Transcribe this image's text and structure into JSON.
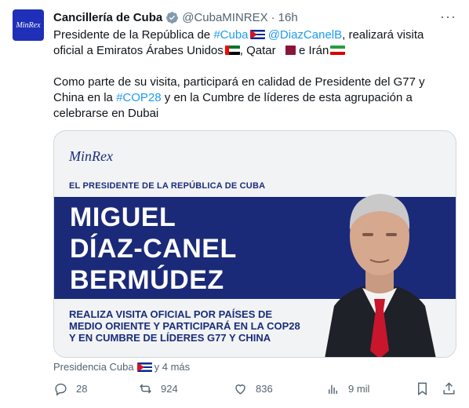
{
  "tweet": {
    "author_name": "Cancillería de Cuba",
    "handle": "@CubaMINREX",
    "separator": "·",
    "time": "16h",
    "more": "···",
    "avatar_text": "MinRex",
    "text": {
      "p1_a": "Presidente de la República de ",
      "hashtag_cuba": "#Cuba",
      "mention": "@DiazCanelB",
      "p1_b": ", realizará visita oficial a Emiratos Árabes Unidos",
      "p1_c": ", Qatar ",
      "p1_d": " e Irán",
      "p2_a": "Como parte de su visita, participará en calidad de Presidente del G77 y China en la ",
      "hashtag_cop": "#COP28",
      "p2_b": " y en la Cumbre de líderes de esta agrupación a celebrarse en Dubai"
    },
    "card": {
      "logo": "MinRex",
      "subtitle": "EL PRESIDENTE DE LA REPÚBLICA DE CUBA",
      "name_line1": "MIGUEL",
      "name_line2": "DÍAZ-CANEL",
      "name_line3": "BERMÚDEZ",
      "desc_line1": "REALIZA VISITA OFICIAL POR PAÍSES DE",
      "desc_line2": "MEDIO ORIENTE Y PARTICIPARÁ EN LA COP28",
      "desc_line3": "Y EN CUMBRE DE LÍDERES G77 Y CHINA"
    },
    "source": {
      "name": "Presidencia Cuba",
      "suffix": "y 4 más"
    },
    "actions": {
      "replies": "28",
      "reposts": "924",
      "likes": "836",
      "views": "9 mil"
    },
    "colors": {
      "link": "#1d9bf0",
      "navy": "#1b2a78",
      "muted": "#536471"
    }
  }
}
